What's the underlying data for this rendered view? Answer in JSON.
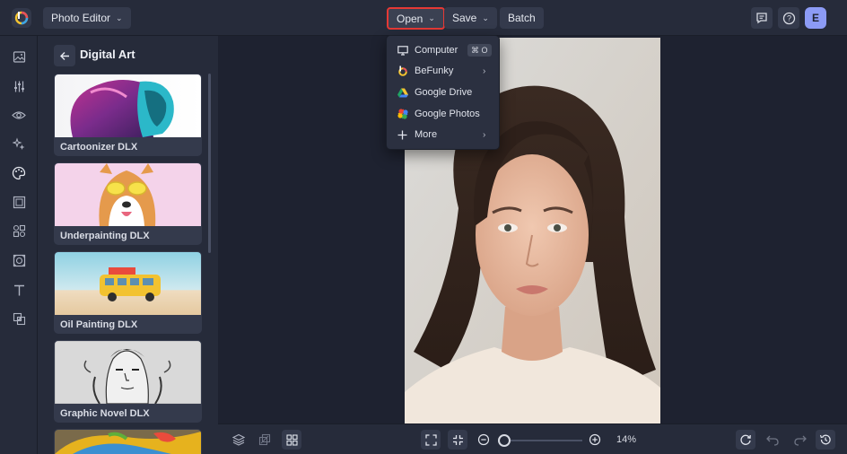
{
  "header": {
    "app_menu_label": "Photo Editor",
    "open_label": "Open",
    "save_label": "Save",
    "batch_label": "Batch",
    "avatar_initial": "E"
  },
  "open_menu": {
    "items": [
      {
        "label": "Computer",
        "icon": "monitor-icon",
        "shortcut": "⌘ O"
      },
      {
        "label": "BeFunky",
        "icon": "befunky-icon",
        "submenu": true
      },
      {
        "label": "Google Drive",
        "icon": "google-drive-icon"
      },
      {
        "label": "Google Photos",
        "icon": "google-photos-icon"
      },
      {
        "label": "More",
        "icon": "plus-icon",
        "submenu": true
      }
    ]
  },
  "panel": {
    "title": "Digital Art",
    "cards": [
      {
        "label": "Cartoonizer DLX"
      },
      {
        "label": "Underpainting DLX"
      },
      {
        "label": "Oil Painting DLX"
      },
      {
        "label": "Graphic Novel DLX"
      }
    ]
  },
  "rail": {
    "icons": [
      "image-icon",
      "sliders-icon",
      "eye-icon",
      "sparkle-icon",
      "palette-icon",
      "frame-icon",
      "graphics-icon",
      "texture-icon",
      "text-icon",
      "overlay-icon"
    ]
  },
  "bottom": {
    "zoom_label": "14%",
    "zoom_level": 0.14
  },
  "colors": {
    "accent_avatar": "#8c9bf5",
    "highlight_border": "#e53935",
    "background": "#1e2230",
    "panel": "#262b3a"
  }
}
